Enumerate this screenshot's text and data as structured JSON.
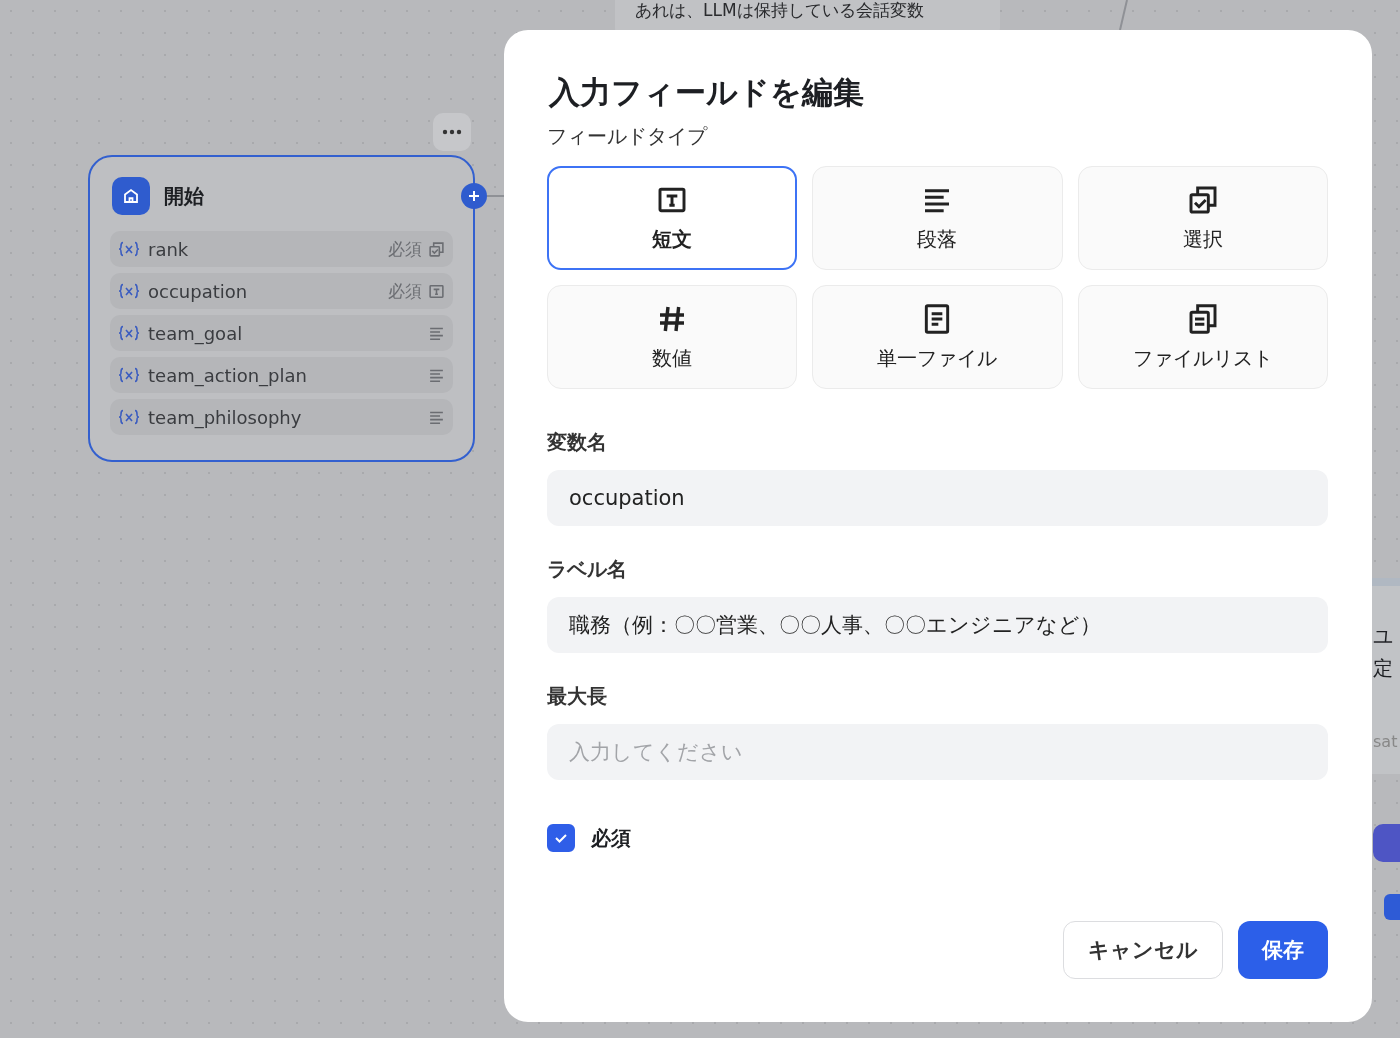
{
  "canvas": {
    "top_node_text": "あれは、LLMは保持している会話変数",
    "right_node_texts": [
      "ユ",
      "定",
      "sat"
    ]
  },
  "start_node": {
    "title": "開始",
    "variables": [
      {
        "name": "rank",
        "badge": "必須",
        "kind": "select"
      },
      {
        "name": "occupation",
        "badge": "必須",
        "kind": "text"
      },
      {
        "name": "team_goal",
        "kind": "paragraph"
      },
      {
        "name": "team_action_plan",
        "kind": "paragraph"
      },
      {
        "name": "team_philosophy",
        "kind": "paragraph"
      }
    ]
  },
  "dialog": {
    "title": "入力フィールドを編集",
    "field_type_label": "フィールドタイプ",
    "field_types": [
      {
        "label": "短文",
        "kind": "text",
        "selected": true
      },
      {
        "label": "段落",
        "kind": "paragraph",
        "selected": false
      },
      {
        "label": "選択",
        "kind": "select",
        "selected": false
      },
      {
        "label": "数値",
        "kind": "number",
        "selected": false
      },
      {
        "label": "単一ファイル",
        "kind": "file",
        "selected": false
      },
      {
        "label": "ファイルリスト",
        "kind": "file-list",
        "selected": false
      }
    ],
    "fields": [
      {
        "label": "変数名",
        "value": "occupation"
      },
      {
        "label": "ラベル名",
        "value": "職務（例：〇〇営業、〇〇人事、〇〇エンジニアなど）"
      },
      {
        "label": "最大長",
        "placeholder": "入力してください"
      }
    ],
    "required": {
      "label": "必須",
      "checked": true
    },
    "buttons": [
      {
        "label": "キャンセル",
        "kind": "secondary"
      },
      {
        "label": "保存",
        "kind": "primary"
      }
    ]
  }
}
